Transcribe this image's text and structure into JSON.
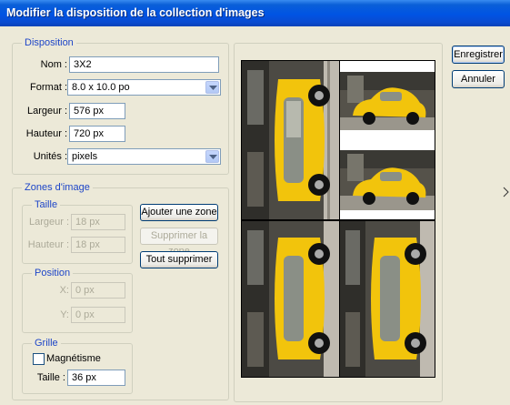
{
  "window": {
    "title": "Modifier la disposition de la collection d'images"
  },
  "actions": {
    "save_label": "Enregistrer",
    "cancel_label": "Annuler"
  },
  "disposition": {
    "legend": "Disposition",
    "name_label": "Nom :",
    "name_value": "3X2",
    "format_label": "Format :",
    "format_value": "8.0 x 10.0 po",
    "width_label": "Largeur :",
    "width_value": "576 px",
    "height_label": "Hauteur :",
    "height_value": "720 px",
    "units_label": "Unités :",
    "units_value": "pixels"
  },
  "zones": {
    "legend": "Zones d'image",
    "size": {
      "legend": "Taille",
      "width_label": "Largeur :",
      "width_value": "18 px",
      "height_label": "Hauteur :",
      "height_value": "18 px"
    },
    "position": {
      "legend": "Position",
      "x_label": "X:",
      "x_value": "0 px",
      "y_label": "Y:",
      "y_value": "0 px"
    },
    "grid": {
      "legend": "Grille",
      "snap_label": "Magnétisme",
      "snap_checked": false,
      "size_label": "Taille :",
      "size_value": "36 px"
    },
    "add_zone_label": "Ajouter une zone",
    "remove_zone_label": "Supprimer la zone",
    "remove_all_label": "Tout supprimer"
  },
  "colors": {
    "car": "#f2c40c",
    "accent": "#0054e3",
    "legend": "#1e46c8"
  }
}
